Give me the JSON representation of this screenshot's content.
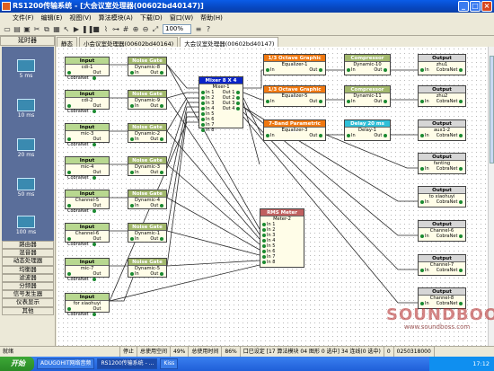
{
  "window": {
    "title": "RS1200传输系统 - [大会议室处理器(00602bd40147)]"
  },
  "menu": [
    "文件(F)",
    "编辑(E)",
    "视图(V)",
    "算法模块(A)",
    "下载(D)",
    "窗口(W)",
    "帮助(H)"
  ],
  "toolbar": {
    "zoom": "100%"
  },
  "left_panel": {
    "header": "延时器",
    "items": [
      "5 ms",
      "10 ms",
      "20 ms",
      "50 ms",
      "100 ms"
    ],
    "categories": [
      "路由器",
      "混音器",
      "动态处理器",
      "均衡器",
      "滤波器",
      "分频器",
      "信号发生器",
      "仪表显示",
      "其他"
    ]
  },
  "tabs": [
    "静态",
    "小会议室处理器(00602bd40164)",
    "大会议室处理器(00602bd40147)"
  ],
  "blocks": {
    "in1": {
      "head": "Input",
      "sub": "cdi-1",
      "net": "CobraNet",
      "out": "Out"
    },
    "in2": {
      "head": "Input",
      "sub": "cdi-2",
      "net": "CobraNet",
      "out": "Out"
    },
    "in3": {
      "head": "Input",
      "sub": "mic-3",
      "net": "CobraNet",
      "out": "Out"
    },
    "in4": {
      "head": "Input",
      "sub": "mic-4",
      "net": "CobraNet",
      "out": "Out"
    },
    "in5": {
      "head": "Input",
      "sub": "Channel-5",
      "net": "CobraNet",
      "out": "Out"
    },
    "in6": {
      "head": "Input",
      "sub": "Channel-6",
      "net": "CobraNet",
      "out": "Out"
    },
    "in7": {
      "head": "Input",
      "sub": "mic-7",
      "net": "CobraNet",
      "out": "Out"
    },
    "in8": {
      "head": "Input",
      "sub": "for xiaohuyi",
      "net": "CobraNet",
      "out": "Out"
    },
    "ng1": {
      "head": "Noise Gate",
      "sub": "Dynamic-8",
      "in": "In",
      "out": "Out"
    },
    "ng2": {
      "head": "Noise Gate",
      "sub": "Dynamic-9",
      "in": "In",
      "out": "Out"
    },
    "ng3": {
      "head": "Noise Gate",
      "sub": "Dynamic-2",
      "in": "In",
      "out": "Out"
    },
    "ng4": {
      "head": "Noise Gate",
      "sub": "Dynamic-3",
      "in": "In",
      "out": "Out"
    },
    "ng5": {
      "head": "Noise Gate",
      "sub": "Dynamic-4",
      "in": "In",
      "out": "Out"
    },
    "ng6": {
      "head": "Noise Gate",
      "sub": "Dynamic-1",
      "in": "In",
      "out": "Out"
    },
    "ng7": {
      "head": "Noise Gate",
      "sub": "Dynamic-5",
      "in": "In",
      "out": "Out"
    },
    "mixer": {
      "head": "Mixer 8 X 4",
      "sub": "Mixer-1",
      "ins": [
        "In 1",
        "In 2",
        "In 3",
        "In 4",
        "In 5",
        "In 6",
        "In 7",
        "In 8"
      ],
      "outs": [
        "Out 1",
        "Out 2",
        "Out 3",
        "Out 4"
      ]
    },
    "eq1": {
      "head": "1/3 Octave Graphic EQ",
      "sub": "Equalizer-1",
      "in": "In",
      "out": "Out"
    },
    "eq2": {
      "head": "1/3 Octave Graphic EQ",
      "sub": "Equalizer-5",
      "in": "In",
      "out": "Out"
    },
    "eq3": {
      "head": "7-Band Parametric EQ",
      "sub": "Equalizer-3",
      "in": "In",
      "out": "Out"
    },
    "comp1": {
      "head": "Compressor",
      "sub": "Dynamic-10",
      "in": "In",
      "out": "Out"
    },
    "comp2": {
      "head": "Compressor",
      "sub": "Dynamic-11",
      "in": "In",
      "out": "Out"
    },
    "delay": {
      "head": "Delay 20 ms",
      "sub": "Delay-1",
      "in": "In",
      "out": "Out"
    },
    "meter": {
      "head": "RMS Meter",
      "sub": "Meter-2",
      "ins": [
        "In 1",
        "In 2",
        "In 3",
        "In 4",
        "In 5",
        "In 6",
        "In 7",
        "In 8"
      ]
    },
    "out1": {
      "head": "Output",
      "sub": "zhu1",
      "in": "In",
      "net": "CobraNet"
    },
    "out2": {
      "head": "Output",
      "sub": "zhu2",
      "in": "In",
      "net": "CobraNet"
    },
    "out3": {
      "head": "Output",
      "sub": "aux1-2",
      "in": "In",
      "net": "CobraNet"
    },
    "out4": {
      "head": "Output",
      "sub": "fanting",
      "in": "In",
      "net": "CobraNet"
    },
    "out5": {
      "head": "Output",
      "sub": "to xiaohuyi",
      "in": "In",
      "net": "CobraNet"
    },
    "out6": {
      "head": "Output",
      "sub": "Channel-6",
      "in": "In",
      "net": "CobraNet"
    },
    "out7": {
      "head": "Output",
      "sub": "Channel-7",
      "in": "In",
      "net": "CobraNet"
    },
    "out8": {
      "head": "Output",
      "sub": "Channel-8",
      "in": "In",
      "net": "CobraNet"
    }
  },
  "statusbar": {
    "ready": "就绪",
    "stop": "停止",
    "total_space": "总使用空间",
    "space_pct": "49%",
    "total_time": "总使用时间",
    "time_pct": "86%",
    "sync": "口已设定 [17 算法模块 04 图形 0 选中] 34 连线(0 选中)",
    "num": "0",
    "id": "0250318000"
  },
  "taskbar": {
    "start": "开始",
    "items": [
      "ADUGOHIT网络音频",
      "RS1200传输系统 - ...",
      "Kiss"
    ],
    "time": "17:12"
  },
  "watermark": {
    "brand": "SOUNDBOOS",
    "url": "www.soundboss.com"
  },
  "colors": {
    "input_head": "#b8d890",
    "noise_gate_head": "#a2b86c",
    "mixer_head": "#0a24c8",
    "eq_head": "#f07810",
    "compressor_head": "#a2b86c",
    "delay_head": "#30c0d8",
    "meter_head": "#c06060",
    "output_head": "#d6d6d6"
  }
}
